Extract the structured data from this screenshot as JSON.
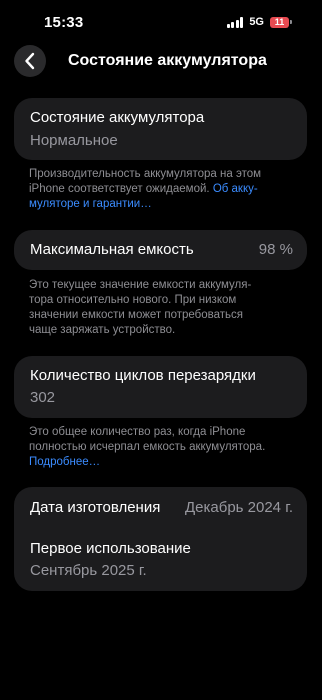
{
  "status_bar": {
    "time": "15:33",
    "network": "5G",
    "battery_level": "11"
  },
  "nav": {
    "title": "Состояние аккумулятора",
    "back_icon": "chevron-left-icon"
  },
  "battery_health": {
    "title": "Состояние аккумулятора",
    "status": "Нормальное",
    "note_lines": [
      "Производительность аккумулятора на этом",
      "iPhone соответствует ожидаемой."
    ],
    "note_link_lines": [
      "Об акку-",
      "муляторе и гарантии…"
    ]
  },
  "max_capacity": {
    "label": "Максимальная емкость",
    "value": "98 %",
    "note_lines": [
      "Это текущее значение емкости аккумуля-",
      "тора относительно нового. При низком",
      "значении емкости может потребоваться",
      "чаще заряжать устройство."
    ]
  },
  "cycle_count": {
    "label": "Количество циклов перезарядки",
    "value": "302",
    "note_lines": [
      "Это общее количество раз, когда iPhone",
      "полностью исчерпал емкость аккумулятора."
    ],
    "note_link": "Подробнее…"
  },
  "dates": {
    "manufacture_label": "Дата изготовления",
    "manufacture_value": "Декабрь 2024 г.",
    "first_use_label": "Первое использование",
    "first_use_value": "Сентябрь 2025 г."
  },
  "colors": {
    "background": "#000000",
    "card": "#1c1c1e",
    "secondary_text": "#98989f",
    "link": "#3b8cff",
    "battery_low": "#e84b52"
  }
}
